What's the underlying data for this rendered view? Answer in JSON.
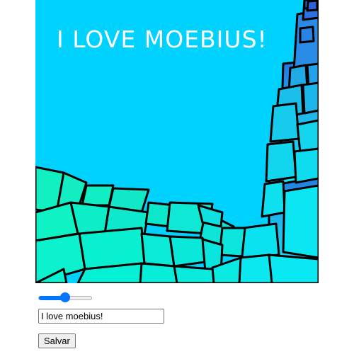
{
  "canvas": {
    "title": "I LOVE MOEBIUS!",
    "sky_color": "#00d2ff"
  },
  "controls": {
    "slider_value": 0.5,
    "text_value": "I love moebius!",
    "save_label": "Salvar"
  },
  "colors": {
    "accent": "#0075ff"
  }
}
